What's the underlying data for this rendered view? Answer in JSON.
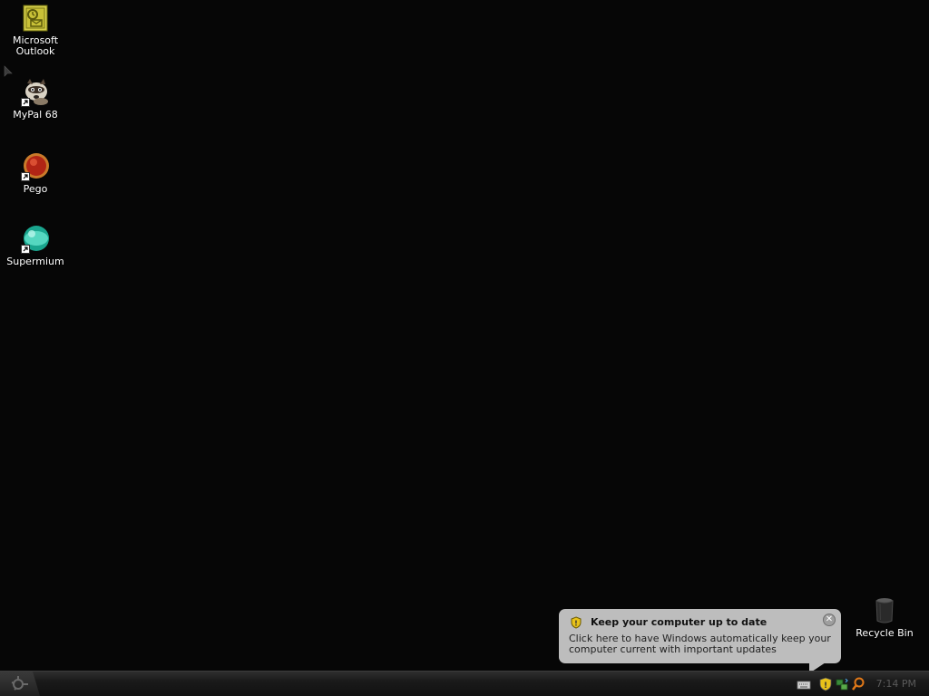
{
  "desktop": {
    "icons": [
      {
        "label": "Microsoft Outlook",
        "icon": "outlook-icon"
      },
      {
        "label": "MyPal 68",
        "icon": "mypal-raccoon-icon"
      },
      {
        "label": "Pego",
        "icon": "pego-red-ball-icon"
      },
      {
        "label": "Supermium",
        "icon": "supermium-globe-icon"
      },
      {
        "label": "Recycle Bin",
        "icon": "recycle-bin-icon"
      }
    ]
  },
  "balloon": {
    "title": "Keep your computer up to date",
    "body": "Click here to have Windows automatically keep your computer current with important updates",
    "close_glyph": "✕"
  },
  "taskbar": {
    "clock": "7:14 PM",
    "tray_icons": [
      "keyboard-icon",
      "security-shield-icon",
      "network-icon",
      "search-icon"
    ]
  },
  "colors": {
    "desktop_bg": "#060606",
    "balloon_bg": "#bdbdbd",
    "taskbar_bg": "#1a1a1a"
  }
}
